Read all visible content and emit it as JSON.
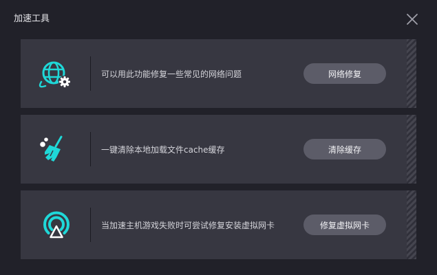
{
  "window": {
    "title": "加速工具",
    "close_icon": "close-icon"
  },
  "colors": {
    "accent": "#1fd8d8",
    "background": "#212129",
    "card": "#373741",
    "button": "#5c5c68"
  },
  "tools": [
    {
      "icon": "network-settings-icon",
      "description": "可以用此功能修复一些常见的网络问题",
      "button_label": "网络修复"
    },
    {
      "icon": "broom-icon",
      "description": "一键清除本地加载文件cache缓存",
      "button_label": "清除缓存"
    },
    {
      "icon": "wifi-hotspot-icon",
      "description": "当加速主机游戏失败时可尝试修复安装虚拟网卡",
      "button_label": "修复虚拟网卡"
    }
  ]
}
